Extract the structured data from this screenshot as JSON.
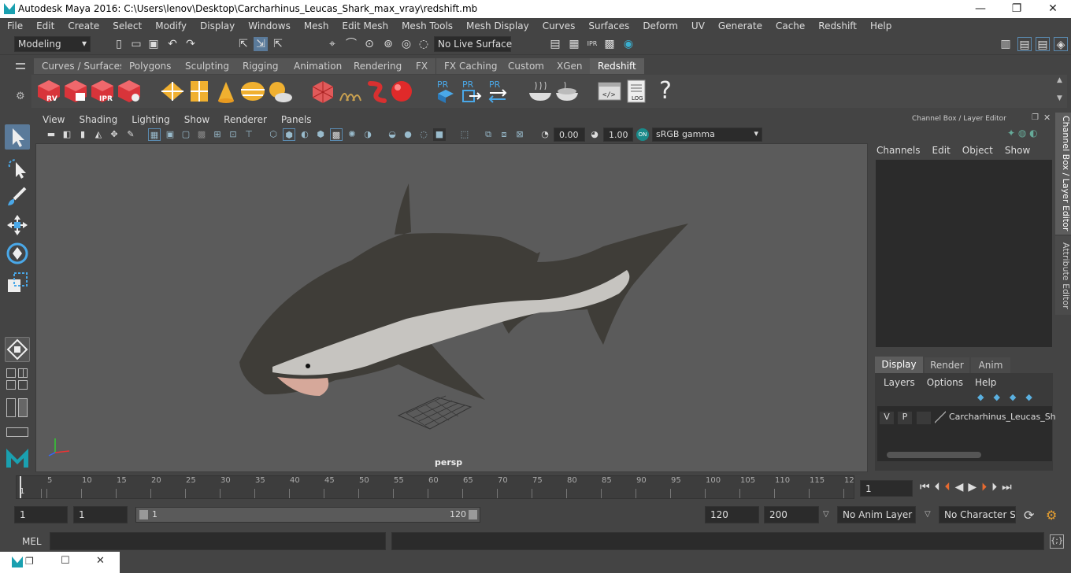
{
  "window": {
    "title": "Autodesk Maya 2016: C:\\Users\\lenov\\Desktop\\Carcharhinus_Leucas_Shark_max_vray\\redshift.mb",
    "minimize": "—",
    "maximize": "❐",
    "close": "✕"
  },
  "menus": [
    "File",
    "Edit",
    "Create",
    "Select",
    "Modify",
    "Display",
    "Windows",
    "Mesh",
    "Edit Mesh",
    "Mesh Tools",
    "Mesh Display",
    "Curves",
    "Surfaces",
    "Deform",
    "UV",
    "Generate",
    "Cache",
    "Redshift",
    "Help"
  ],
  "status": {
    "mode": "Modeling",
    "live_surface": "No Live Surface"
  },
  "shelf_tabs": [
    "Curves / Surfaces",
    "Polygons",
    "Sculpting",
    "Rigging",
    "Animation",
    "Rendering",
    "FX",
    "FX Caching",
    "Custom",
    "XGen",
    "Redshift"
  ],
  "shelf_active": "Redshift",
  "shelf_labels": {
    "rv": "RV",
    "ipr": "IPR",
    "pr1": "PR",
    "pr2": "PR",
    "pr3": "PR",
    "log": "LOG",
    "help": "?"
  },
  "viewport": {
    "menus": [
      "View",
      "Shading",
      "Lighting",
      "Show",
      "Renderer",
      "Panels"
    ],
    "exposure": "0.00",
    "gamma": "1.00",
    "colorspace": "sRGB gamma",
    "camera": "persp"
  },
  "channelbox": {
    "title": "Channel Box / Layer Editor",
    "menus": [
      "Channels",
      "Edit",
      "Object",
      "Show"
    ],
    "layer_tabs": [
      "Display",
      "Render",
      "Anim"
    ],
    "layer_tab_active": "Display",
    "layer_menus": [
      "Layers",
      "Options",
      "Help"
    ],
    "layer": {
      "v": "V",
      "p": "P",
      "name": "Carcharhinus_Leucas_Sh"
    }
  },
  "side_tabs": {
    "channel": "Channel Box / Layer Editor",
    "attr": "Attribute Editor"
  },
  "timeline": {
    "ticks": [
      "1",
      "5",
      "10",
      "15",
      "20",
      "25",
      "30",
      "35",
      "40",
      "45",
      "50",
      "55",
      "60",
      "65",
      "70",
      "75",
      "80",
      "85",
      "90",
      "95",
      "100",
      "105",
      "110",
      "115",
      "12"
    ],
    "current": "1"
  },
  "range": {
    "start": "1",
    "inner_start": "1",
    "slider_start": "1",
    "slider_end": "120",
    "end": "120",
    "max": "200",
    "anim_layer": "No Anim Layer",
    "char_set": "No Character Set"
  },
  "cmd": {
    "label": "MEL"
  }
}
